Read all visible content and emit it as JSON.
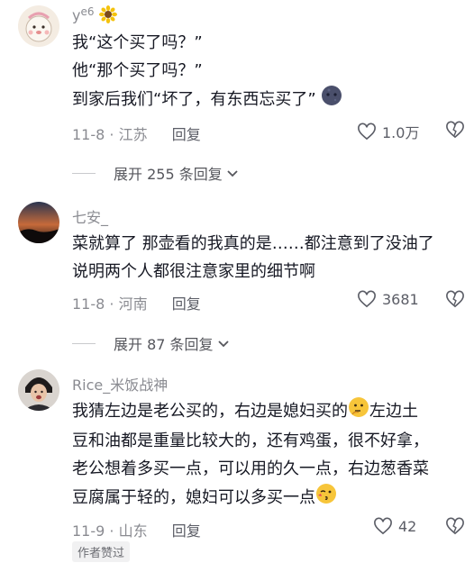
{
  "comments": [
    {
      "username": "yₘ⁲₀̶⁶",
      "username_display": "y°⁶",
      "lines": [
        "我“这个买了吗？”",
        "他“那个买了吗？”",
        "到家后我们“坏了，有东西忘买了”"
      ],
      "date": "11-8",
      "location": "江苏",
      "reply_label": "回复",
      "likes": "1.0万",
      "expand_label": "展开 255 条回复"
    },
    {
      "username": "七安_",
      "lines": [
        "菜就算了 那壶看的我真的是……都注意到了没油了",
        "说明两个人都很注意家里的细节啊"
      ],
      "date": "11-8",
      "location": "河南",
      "reply_label": "回复",
      "likes": "3681",
      "expand_label": "展开 87 条回复"
    },
    {
      "username": "Rice_米饭战神",
      "lines": [
        "我猜左边是老公买的，右边是媳妇买的",
        "豆和油都是重量比较大的，还有鸡蛋，很不好拿，",
        "老公想着多买一点，可以用的久一点，右边葱香菜",
        "豆腐属于轻的，媳妇可以多买一点"
      ],
      "line1_tail": "左边土",
      "date": "11-9",
      "location": "山东",
      "reply_label": "回复",
      "likes": "42",
      "badge": "作者赞过"
    }
  ],
  "separator": "·"
}
